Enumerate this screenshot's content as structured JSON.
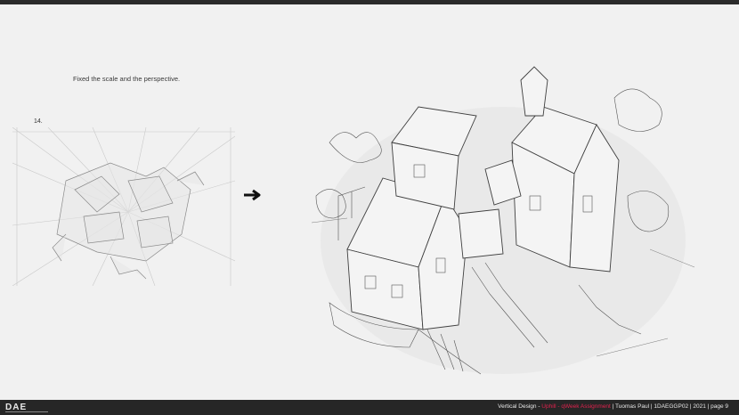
{
  "slide": {
    "caption": "Fixed the scale and the perspective.",
    "sketch_number": "14."
  },
  "footer": {
    "course": "Vertical Design - ",
    "project": "Uphill - qWeek Assignment",
    "details": " | Tuomas Paul | 1DAEGGP02 | 2021 | page 9"
  },
  "colors": {
    "accent": "#e0234e",
    "footer_bg": "#262626",
    "page_bg": "#f1f1f1"
  },
  "icons": {
    "arrow": "arrow-right-icon",
    "logo": "dae-logo"
  }
}
